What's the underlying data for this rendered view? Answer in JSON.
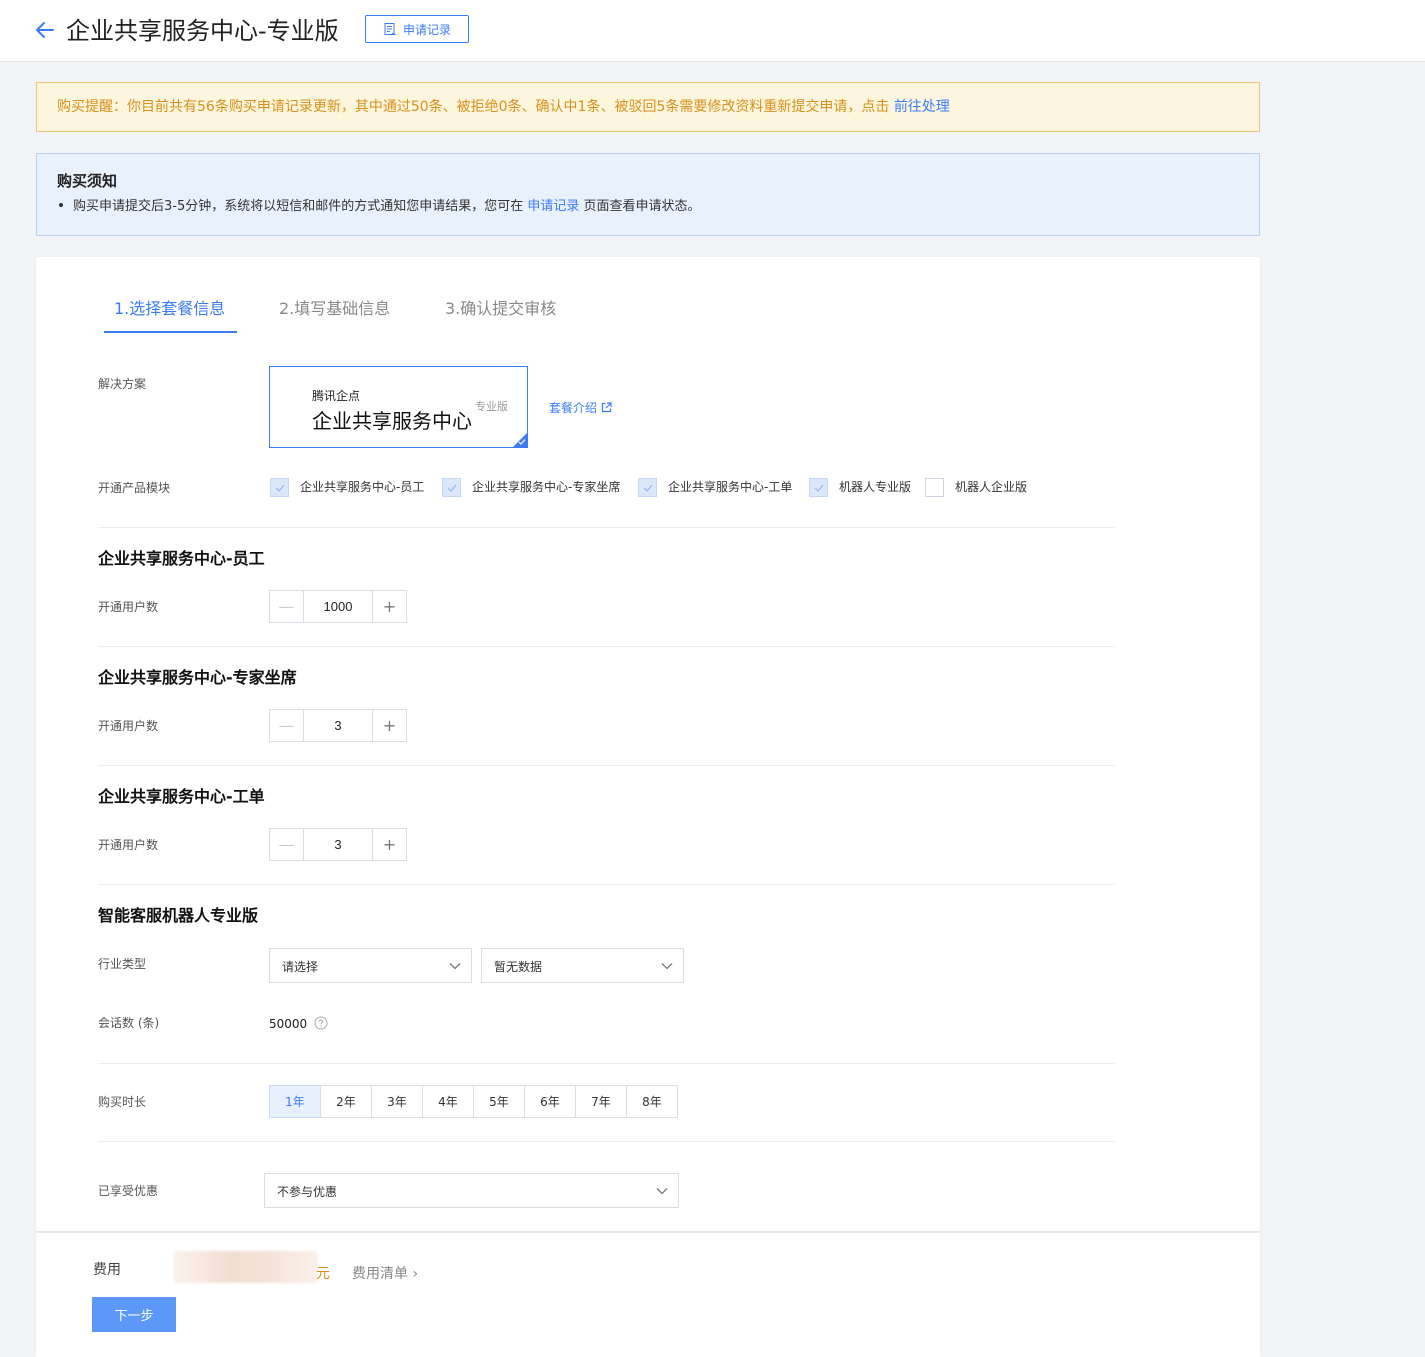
{
  "header": {
    "title": "企业共享服务中心-专业版",
    "record_button": "申请记录"
  },
  "alert": {
    "text": "购买提醒：你目前共有56条购买申请记录更新，其中通过50条、被拒绝0条、确认中1条、被驳回5条需要修改资料重新提交申请，点击",
    "link": "前往处理"
  },
  "notice": {
    "title": "购买须知",
    "text_before": "购买申请提交后3-5分钟，系统将以短信和邮件的方式通知您申请结果，您可在",
    "link": "申请记录",
    "text_after": "页面查看申请状态。"
  },
  "steps": [
    {
      "label": "1.选择套餐信息",
      "active": true
    },
    {
      "label": "2.填写基础信息",
      "active": false
    },
    {
      "label": "3.确认提交审核",
      "active": false
    }
  ],
  "solution": {
    "label": "解决方案",
    "brand": "腾讯企点",
    "name": "企业共享服务中心",
    "tier": "专业版",
    "intro_link": "套餐介绍"
  },
  "modules": {
    "label": "开通产品模块",
    "items": [
      {
        "label": "企业共享服务中心-员工",
        "checked": true
      },
      {
        "label": "企业共享服务中心-专家坐席",
        "checked": true
      },
      {
        "label": "企业共享服务中心-工单",
        "checked": true
      },
      {
        "label": "机器人专业版",
        "checked": true
      },
      {
        "label": "机器人企业版",
        "checked": false
      }
    ]
  },
  "sections": {
    "staff": {
      "title": "企业共享服务中心-员工",
      "users_label": "开通用户数",
      "users": "1000"
    },
    "expert": {
      "title": "企业共享服务中心-专家坐席",
      "users_label": "开通用户数",
      "users": "3"
    },
    "ticket": {
      "title": "企业共享服务中心-工单",
      "users_label": "开通用户数",
      "users": "3"
    },
    "robot": {
      "title": "智能客服机器人专业版",
      "industry_label": "行业类型",
      "industry_value": "请选择",
      "sub_industry_value": "暂无数据",
      "sessions_label": "会话数 (条)",
      "sessions_value": "50000"
    }
  },
  "duration": {
    "label": "购买时长",
    "options": [
      "1年",
      "2年",
      "3年",
      "4年",
      "5年",
      "6年",
      "7年",
      "8年"
    ],
    "selected": "1年"
  },
  "discount": {
    "label": "已享受优惠",
    "value": "不参与优惠"
  },
  "footer": {
    "fee_label": "费用",
    "unit": "元",
    "fee_list": "费用清单",
    "next_button": "下一步"
  },
  "colors": {
    "accent": "#3b7cf6",
    "warning_text": "#d9901b",
    "warning_bg": "#fdf6df",
    "notice_bg": "#e9f1fd"
  }
}
